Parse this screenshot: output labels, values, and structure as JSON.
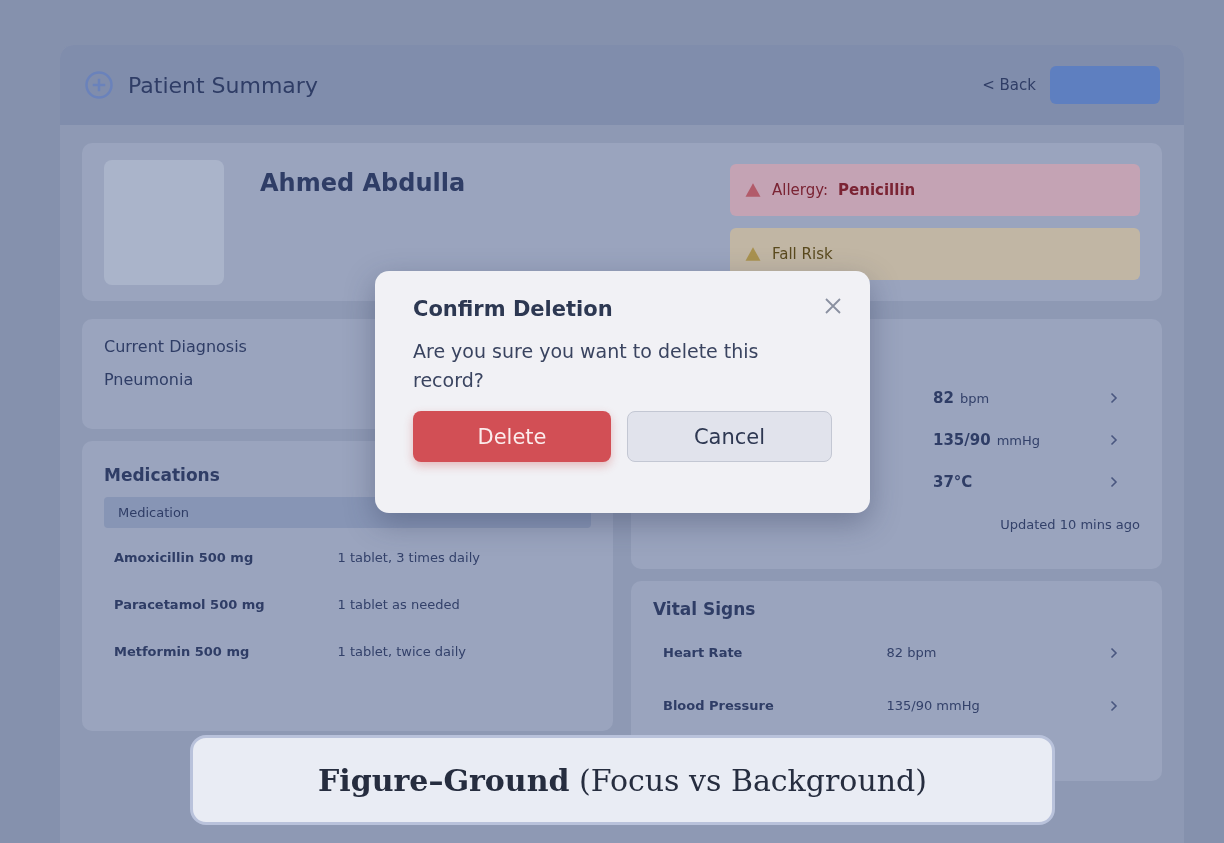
{
  "header": {
    "title": "Patient Summary",
    "back": "< Back"
  },
  "patient": {
    "name": "Ahmed Abdulla"
  },
  "alerts": [
    {
      "kind": "danger",
      "label": "Allergy:",
      "value": "Penicillin"
    },
    {
      "kind": "warning",
      "label": "Fall Risk"
    }
  ],
  "diagnosis": {
    "label": "Current Diagnosis",
    "value": "Pneumonia"
  },
  "medications": {
    "title": "Medications",
    "column": "Medication",
    "rows": [
      {
        "name": "Amoxicillin 500 mg",
        "dose": "1 tablet, 3 times daily"
      },
      {
        "name": "Paracetamol 500 mg",
        "dose": "1 tablet as needed"
      },
      {
        "name": "Metformin 500 mg",
        "dose": "1 tablet, twice daily"
      }
    ]
  },
  "vitals_summary": {
    "rows": [
      {
        "value": "82",
        "unit": "bpm"
      },
      {
        "value": "135/90",
        "unit": "mmHg"
      },
      {
        "value": "37°C"
      }
    ],
    "updated": "Updated 10 mins ago"
  },
  "vital_signs": {
    "title": "Vital Signs",
    "rows": [
      {
        "label": "Heart Rate",
        "value": "82 bpm"
      },
      {
        "label": "Blood Pressure",
        "value": "135/90 mmHg"
      }
    ]
  },
  "dialog": {
    "title": "Confirm Deletion",
    "message": "Are you sure you want to delete this record?",
    "buttons": [
      {
        "label": "Delete",
        "kind": "danger"
      },
      {
        "label": "Cancel",
        "kind": "secondary"
      }
    ]
  },
  "caption": "**Figure–Ground** (Focus vs Background)"
}
